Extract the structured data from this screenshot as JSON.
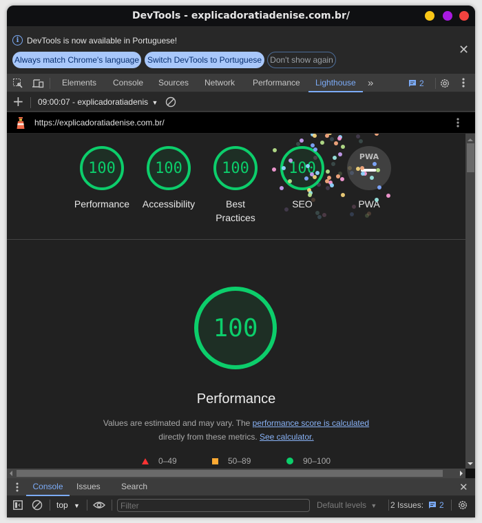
{
  "window": {
    "title": "DevTools - explicadoratiadenise.com.br/"
  },
  "infobar": {
    "message": "DevTools is now available in Portuguese!",
    "buttons": [
      {
        "label": "Always match Chrome's language"
      },
      {
        "label": "Switch DevTools to Portuguese"
      },
      {
        "label": "Don't show again"
      }
    ],
    "close_glyph": "✕"
  },
  "tabs": {
    "items": [
      {
        "label": "Elements"
      },
      {
        "label": "Console"
      },
      {
        "label": "Sources"
      },
      {
        "label": "Network"
      },
      {
        "label": "Performance"
      },
      {
        "label": "Lighthouse",
        "active": true
      }
    ],
    "more_glyph": "»",
    "issues_count": "2"
  },
  "lighthouse_toolbar": {
    "add_glyph": "+",
    "report_selector": "09:00:07 - explicadoratiadenis",
    "dropdown_glyph": "▼"
  },
  "url_bar": {
    "url": "https://explicadoratiadenise.com.br/"
  },
  "scores": [
    {
      "category": "Performance",
      "score": "100"
    },
    {
      "category": "Accessibility",
      "score": "100"
    },
    {
      "category": "Best Practices",
      "score": "100"
    },
    {
      "category": "SEO",
      "score": "100"
    },
    {
      "category": "PWA",
      "badge": "PWA",
      "score": "—"
    }
  ],
  "performance": {
    "score": "100",
    "title": "Performance",
    "desc_prefix": "Values are estimated and may vary. The ",
    "desc_link1": "performance score is calculated",
    "desc_middle": " directly from these metrics. ",
    "desc_link2": "See calculator.",
    "legend": [
      {
        "shape": "triangle",
        "range": "0–49",
        "color": "#ff3333"
      },
      {
        "shape": "square",
        "range": "50–89",
        "color": "#ffaa33"
      },
      {
        "shape": "circle",
        "range": "90–100",
        "color": "#0cce6b"
      }
    ]
  },
  "drawer": {
    "tabs": [
      {
        "label": "Console",
        "active": true
      },
      {
        "label": "Issues"
      },
      {
        "label": "Search"
      }
    ],
    "close_glyph": "✕",
    "context": "top",
    "filter_placeholder": "Filter",
    "levels": "Default levels",
    "issues_label": "2 Issues:",
    "issues_count": "2"
  },
  "colors": {
    "pass": "#0cce6b",
    "accent": "#7cacf8",
    "pill": "#a8c7fa"
  }
}
